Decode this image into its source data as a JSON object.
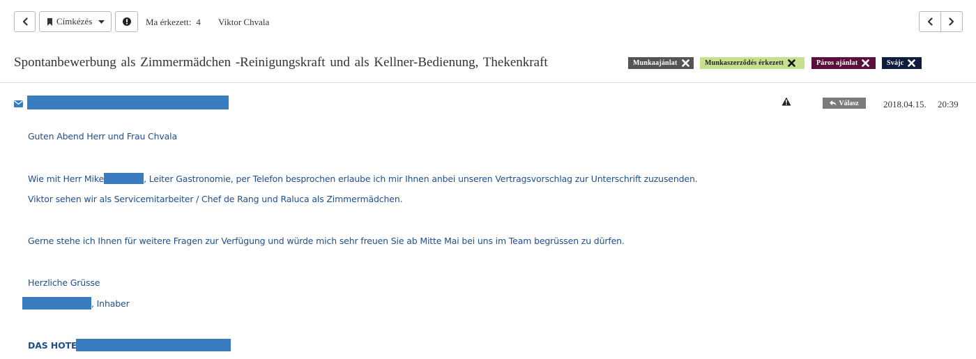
{
  "toolbar": {
    "label_button": "Címkézés",
    "arrived_label": "Ma érkezett:",
    "arrived_count": "4",
    "sender_name": "Viktor Chvala"
  },
  "subject": "Spontanbewerbung  als Zimmermädchen -Reinigungskraft und als Kellner-Bedienung,  Thekenkraft",
  "tags": [
    {
      "label": "Munkaajánlat",
      "bg": "#555555"
    },
    {
      "label": "Munkaszerződés érkezett",
      "bg": "#c6e18e"
    },
    {
      "label": "Páros ajánlat",
      "bg": "#5b0f3d"
    },
    {
      "label": "Svájc",
      "bg": "#0f1c3f"
    }
  ],
  "message": {
    "reply_label": "Válasz",
    "date": "2018.04.15.",
    "time": "20:39",
    "body": {
      "greeting": "Guten Abend Herr und Frau Chvala",
      "p1_prefix": "Wie mit Herr Mike",
      "p1_suffix": ", Leiter Gastronomie, per Telefon besprochen erlaube ich mir Ihnen anbei unseren Vertragsvorschlag zur Unterschrift zuzusenden.",
      "p2": "Viktor sehen wir als Servicemitarbeiter / Chef de Rang und Raluca als Zimmermädchen.",
      "p3": "Gerne stehe ich Ihnen für weitere Fragen zur Verfügung und würde mich sehr freuen Sie ab Mitte Mai bei uns im Team begrüssen zu dürfen.",
      "closing": "Herzliche Grüsse",
      "signature_suffix": ", Inhaber",
      "company_prefix": "DAS HOTEL"
    }
  },
  "icons": [
    "chevron-left-icon",
    "bookmark-icon",
    "caret-down-icon",
    "info-icon",
    "chevron-right-icon",
    "close-icon",
    "envelope-icon",
    "warning-icon",
    "reply-icon"
  ]
}
